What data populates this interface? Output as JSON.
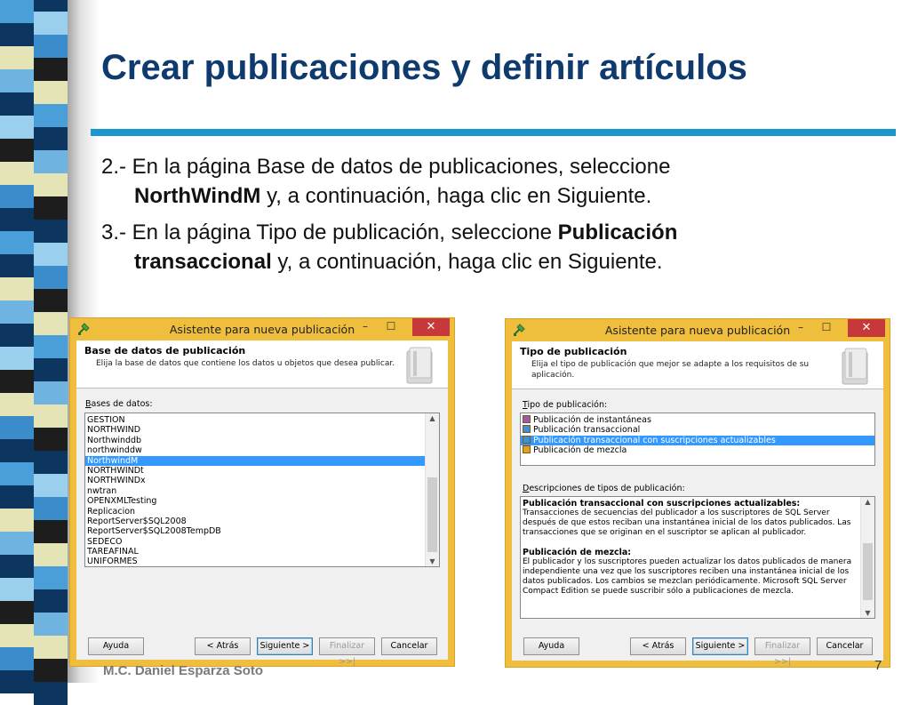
{
  "slide": {
    "title": "Crear publicaciones y definir artículos",
    "bullet2": {
      "prefix": "2.- En la página Base de datos de publicaciones, seleccione",
      "bold": "NorthWindM",
      "suffix": " y, a continuación, haga clic en Siguiente."
    },
    "bullet3": {
      "prefix": "3.- En la página Tipo de publicación, seleccione ",
      "bold1": "Publicación",
      "bold2": "transaccional",
      "suffix": " y, a continuación, haga clic en Siguiente."
    },
    "footer": "M.C. Daniel Esparza Soto",
    "page_number": "7"
  },
  "colors": {
    "title": "#0f3a6e",
    "rule": "#1b97d0",
    "dialog_frame": "#f0be3d",
    "close_button": "#c7383a",
    "selection": "#3399ff"
  },
  "dialog1": {
    "window_title": "Asistente para nueva publicación",
    "minimize_glyph": "–",
    "maximize_glyph": "☐",
    "close_glyph": "✕",
    "header_title": "Base de datos de publicación",
    "header_subtitle": "Elija la base de datos que contiene los datos u objetos que desea publicar.",
    "list_label_accel": "B",
    "list_label_rest": "ases de datos:",
    "databases": [
      "GESTION",
      "NORTHWIND",
      "Northwinddb",
      "northwinddw",
      "NorthwindM",
      "NORTHWINDt",
      "NORTHWINDx",
      "nwtran",
      "OPENXMLTesting",
      "Replicacion",
      "ReportServer$SQL2008",
      "ReportServer$SQL2008TempDB",
      "SEDECO",
      "TAREAFINAL",
      "UNIFORMES"
    ],
    "selected_database": "NorthwindM",
    "buttons": {
      "help": "Ayuda",
      "back": "< Atrás",
      "next": "Siguiente >",
      "finish": "Finalizar >>|",
      "cancel": "Cancelar"
    }
  },
  "dialog2": {
    "window_title": "Asistente para nueva publicación",
    "minimize_glyph": "–",
    "maximize_glyph": "☐",
    "close_glyph": "✕",
    "header_title": "Tipo de publicación",
    "header_subtitle_1": "Elija el tipo de publicación que mejor se adapte a los requisitos de su",
    "header_subtitle_2": "aplicación.",
    "type_label_accel": "T",
    "type_label_rest": "ipo de publicación:",
    "types": [
      {
        "label": "Publicación de instantáneas",
        "icon": "snapshot-publication-icon",
        "color": "#9b59b6"
      },
      {
        "label": "Publicación transaccional",
        "icon": "transactional-publication-icon",
        "color": "#3f8fd6"
      },
      {
        "label": "Publicación transaccional con suscripciones actualizables",
        "icon": "updatable-publication-icon",
        "color": "#3f8fd6"
      },
      {
        "label": "Publicación de mezcla",
        "icon": "merge-publication-icon",
        "color": "#e0a020"
      }
    ],
    "selected_type": "Publicación transaccional con suscripciones actualizables",
    "desc_label_accel": "D",
    "desc_label_rest": "escripciones de tipos de publicación:",
    "descriptions": [
      {
        "heading": "Publicación transaccional con suscripciones actualizables:",
        "text": "Transacciones de secuencias del publicador a los suscriptores de SQL Server después de que estos reciban una instantánea inicial de los datos publicados. Las transacciones que se originan en el suscriptor se aplican al publicador."
      },
      {
        "heading": "Publicación de mezcla:",
        "text": "El publicador y los suscriptores pueden actualizar los datos publicados de manera independiente una vez que los suscriptores reciben una instantánea inicial de los datos publicados. Los cambios se mezclan periódicamente. Microsoft SQL Server Compact Edition se puede suscribir sólo a publicaciones de mezcla."
      }
    ],
    "buttons": {
      "help": "Ayuda",
      "back": "< Atrás",
      "next": "Siguiente >",
      "finish": "Finalizar >>|",
      "cancel": "Cancelar"
    }
  }
}
